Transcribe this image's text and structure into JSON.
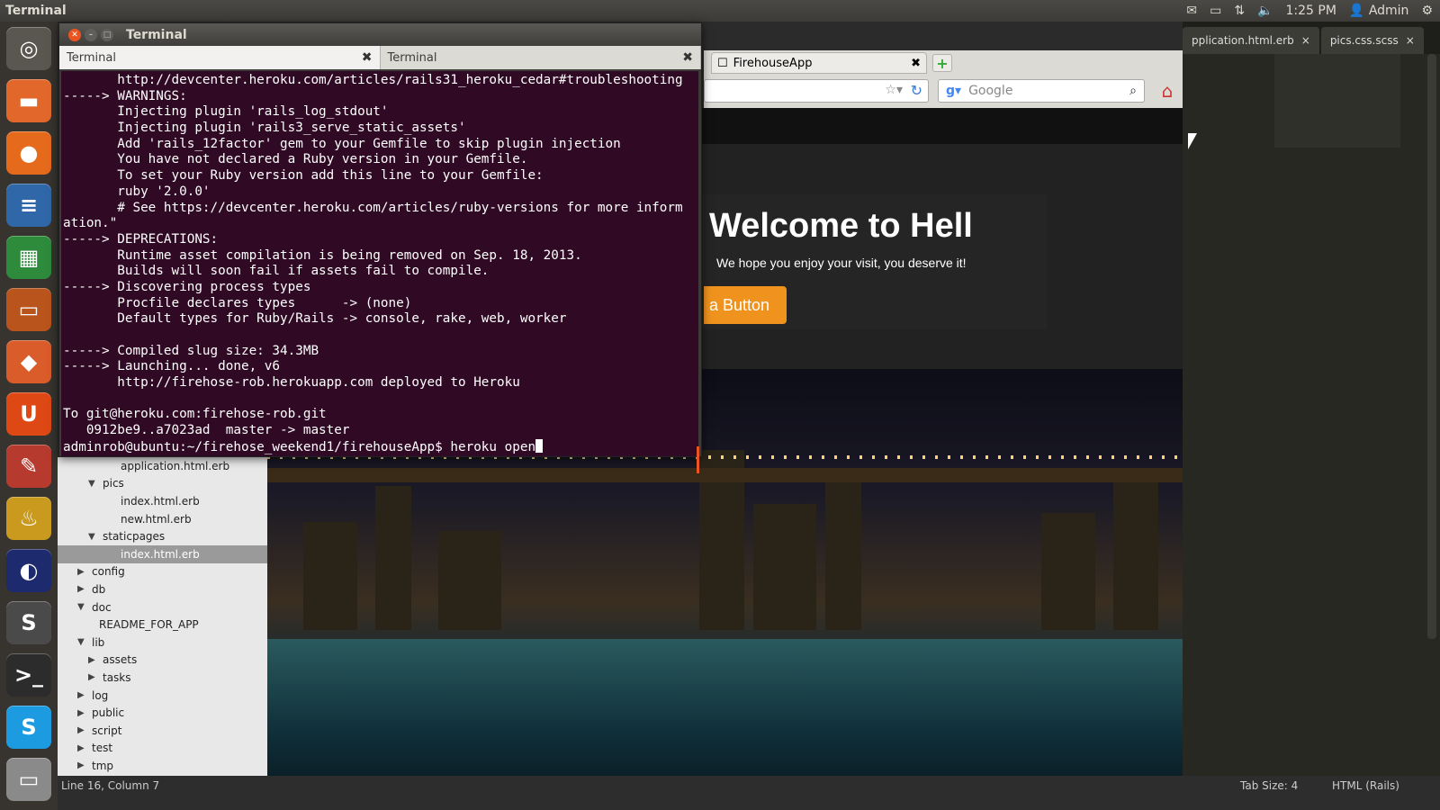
{
  "top_panel": {
    "app_title": "Terminal",
    "time": "1:25 PM",
    "user": "Admin",
    "icons": [
      "mail-icon",
      "battery-icon",
      "network-icon",
      "volume-icon",
      "user-icon",
      "gear-icon"
    ]
  },
  "launcher": {
    "items": [
      {
        "name": "dash-home-icon",
        "glyph": "◎",
        "color": "#5a5650"
      },
      {
        "name": "files-icon",
        "glyph": "▬",
        "color": "#e2672b"
      },
      {
        "name": "firefox-icon",
        "glyph": "●",
        "color": "#e66a1c"
      },
      {
        "name": "writer-icon",
        "glyph": "≡",
        "color": "#2f67a8"
      },
      {
        "name": "calc-icon",
        "glyph": "▦",
        "color": "#2e8b3c"
      },
      {
        "name": "impress-icon",
        "glyph": "▭",
        "color": "#b8541c"
      },
      {
        "name": "software-center-icon",
        "glyph": "◆",
        "color": "#d95c2a"
      },
      {
        "name": "ubuntu-one-icon",
        "glyph": "U",
        "color": "#dd4814"
      },
      {
        "name": "system-settings-icon",
        "glyph": "✎",
        "color": "#b73a2e"
      },
      {
        "name": "genie-icon",
        "glyph": "♨",
        "color": "#c99a1e"
      },
      {
        "name": "eclipse-icon",
        "glyph": "◐",
        "color": "#1e2a6e"
      },
      {
        "name": "sublime-text-icon",
        "glyph": "S",
        "color": "#4a4a4a"
      },
      {
        "name": "terminal-icon",
        "glyph": ">_",
        "color": "#2c2c2c"
      },
      {
        "name": "skype-icon",
        "glyph": "S",
        "color": "#1c9be0"
      },
      {
        "name": "disk-icon",
        "glyph": "▭",
        "color": "#8a8a8a"
      }
    ]
  },
  "terminal": {
    "window_title": "Terminal",
    "tabs": [
      "Terminal",
      "Terminal"
    ],
    "lines": [
      "       http://devcenter.heroku.com/articles/rails31_heroku_cedar#troubleshooting",
      "-----> WARNINGS:",
      "       Injecting plugin 'rails_log_stdout'",
      "       Injecting plugin 'rails3_serve_static_assets'",
      "       Add 'rails_12factor' gem to your Gemfile to skip plugin injection",
      "       You have not declared a Ruby version in your Gemfile.",
      "       To set your Ruby version add this line to your Gemfile:",
      "       ruby '2.0.0'",
      "       # See https://devcenter.heroku.com/articles/ruby-versions for more inform",
      "ation.\"",
      "-----> DEPRECATIONS:",
      "       Runtime asset compilation is being removed on Sep. 18, 2013.",
      "       Builds will soon fail if assets fail to compile.",
      "-----> Discovering process types",
      "       Procfile declares types      -> (none)",
      "       Default types for Ruby/Rails -> console, rake, web, worker",
      "",
      "-----> Compiled slug size: 34.3MB",
      "-----> Launching... done, v6",
      "       http://firehose-rob.herokuapp.com deployed to Heroku",
      "",
      "To git@heroku.com:firehose-rob.git",
      "   0912be9..a7023ad  master -> master"
    ],
    "prompt": "adminrob@ubuntu:~/firehose_weekend1/firehouseApp$ ",
    "command": "heroku open"
  },
  "firefox": {
    "tab_title": "FirehouseApp",
    "search_placeholder": "Google"
  },
  "webpage": {
    "hero_title": "Welcome to Hell",
    "hero_subtitle": "We hope you enjoy your visit, you deserve it!",
    "button_label": "a Button"
  },
  "sublime": {
    "tabs": [
      "pplication.html.erb",
      "pics.css.scss"
    ],
    "sidebar": [
      {
        "label": "application.html.erb",
        "indent": 3,
        "kind": "file"
      },
      {
        "label": "pics",
        "indent": 2,
        "kind": "open"
      },
      {
        "label": "index.html.erb",
        "indent": 3,
        "kind": "file"
      },
      {
        "label": "new.html.erb",
        "indent": 3,
        "kind": "file"
      },
      {
        "label": "staticpages",
        "indent": 2,
        "kind": "open"
      },
      {
        "label": "index.html.erb",
        "indent": 3,
        "kind": "file",
        "selected": true
      },
      {
        "label": "config",
        "indent": 1,
        "kind": "closed"
      },
      {
        "label": "db",
        "indent": 1,
        "kind": "closed"
      },
      {
        "label": "doc",
        "indent": 1,
        "kind": "open"
      },
      {
        "label": "README_FOR_APP",
        "indent": 2,
        "kind": "file"
      },
      {
        "label": "lib",
        "indent": 1,
        "kind": "open"
      },
      {
        "label": "assets",
        "indent": 2,
        "kind": "closed"
      },
      {
        "label": "tasks",
        "indent": 2,
        "kind": "closed"
      },
      {
        "label": "log",
        "indent": 1,
        "kind": "closed"
      },
      {
        "label": "public",
        "indent": 1,
        "kind": "closed"
      },
      {
        "label": "script",
        "indent": 1,
        "kind": "closed"
      },
      {
        "label": "test",
        "indent": 1,
        "kind": "closed"
      },
      {
        "label": "tmp",
        "indent": 1,
        "kind": "closed"
      }
    ],
    "status_position": "Line 16, Column 7",
    "status_tab_size": "Tab Size: 4",
    "status_syntax": "HTML (Rails)"
  }
}
